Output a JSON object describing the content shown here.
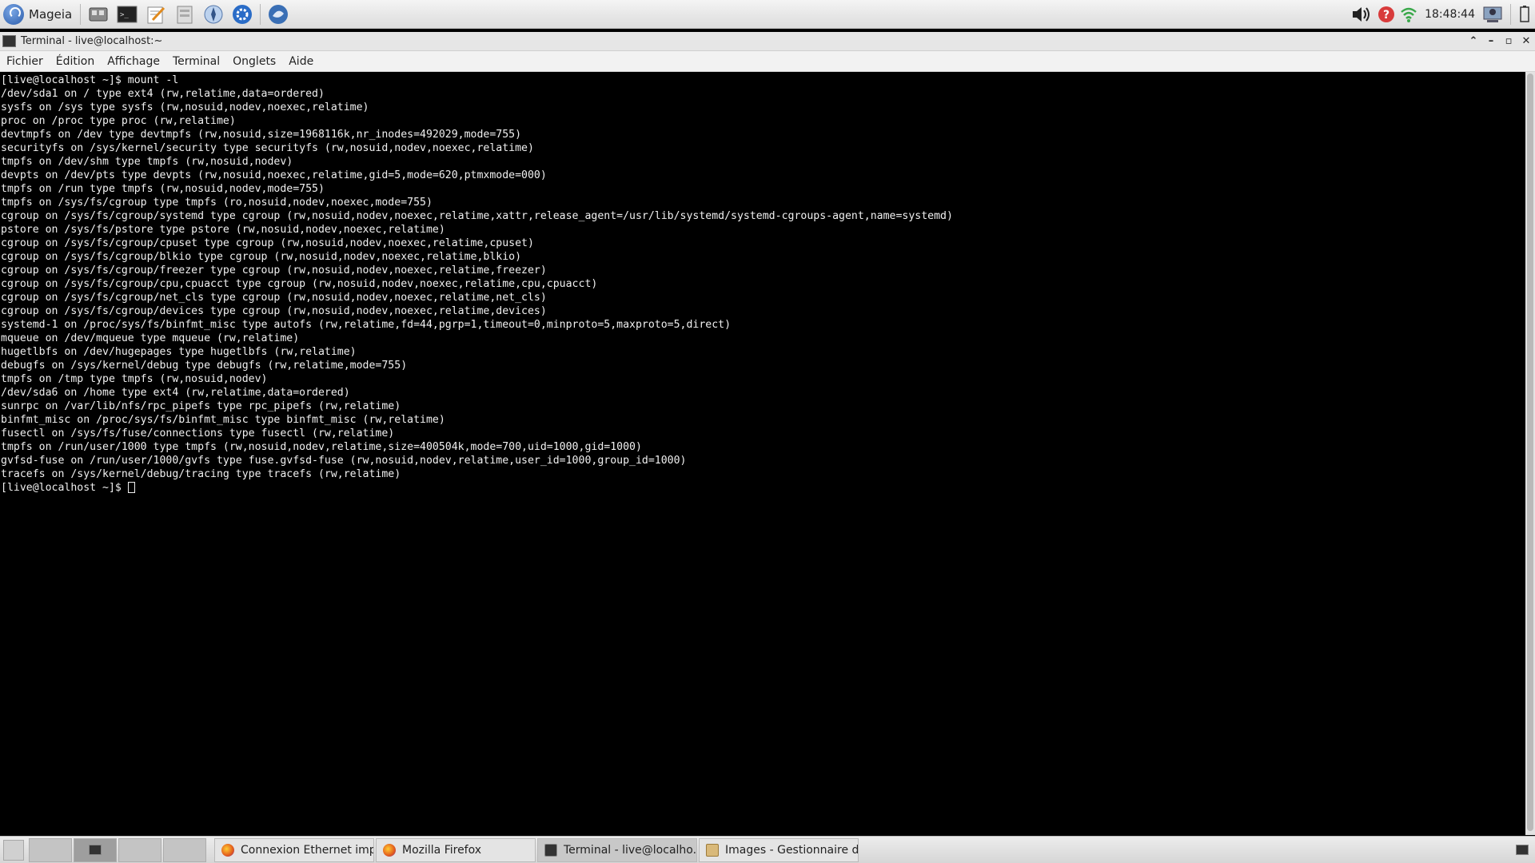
{
  "top_panel": {
    "menu_label": "Mageia",
    "launchers": [
      {
        "icon": "control-center-icon"
      },
      {
        "icon": "terminal-icon"
      },
      {
        "icon": "text-editor-icon"
      },
      {
        "icon": "file-manager-icon"
      },
      {
        "icon": "web-browser-icon"
      },
      {
        "icon": "settings-icon"
      },
      {
        "icon": "mail-icon"
      }
    ],
    "clock": "18:48:44",
    "colors": {
      "accent": "#2a5ba9",
      "help": "#d83b3b",
      "wifi": "#3aa84a"
    }
  },
  "window": {
    "title": "Terminal - live@localhost:~",
    "menu": [
      "Fichier",
      "Édition",
      "Affichage",
      "Terminal",
      "Onglets",
      "Aide"
    ]
  },
  "terminal": {
    "lines": [
      "[live@localhost ~]$ mount -l",
      "/dev/sda1 on / type ext4 (rw,relatime,data=ordered)",
      "sysfs on /sys type sysfs (rw,nosuid,nodev,noexec,relatime)",
      "proc on /proc type proc (rw,relatime)",
      "devtmpfs on /dev type devtmpfs (rw,nosuid,size=1968116k,nr_inodes=492029,mode=755)",
      "securityfs on /sys/kernel/security type securityfs (rw,nosuid,nodev,noexec,relatime)",
      "tmpfs on /dev/shm type tmpfs (rw,nosuid,nodev)",
      "devpts on /dev/pts type devpts (rw,nosuid,noexec,relatime,gid=5,mode=620,ptmxmode=000)",
      "tmpfs on /run type tmpfs (rw,nosuid,nodev,mode=755)",
      "tmpfs on /sys/fs/cgroup type tmpfs (ro,nosuid,nodev,noexec,mode=755)",
      "cgroup on /sys/fs/cgroup/systemd type cgroup (rw,nosuid,nodev,noexec,relatime,xattr,release_agent=/usr/lib/systemd/systemd-cgroups-agent,name=systemd)",
      "pstore on /sys/fs/pstore type pstore (rw,nosuid,nodev,noexec,relatime)",
      "cgroup on /sys/fs/cgroup/cpuset type cgroup (rw,nosuid,nodev,noexec,relatime,cpuset)",
      "cgroup on /sys/fs/cgroup/blkio type cgroup (rw,nosuid,nodev,noexec,relatime,blkio)",
      "cgroup on /sys/fs/cgroup/freezer type cgroup (rw,nosuid,nodev,noexec,relatime,freezer)",
      "cgroup on /sys/fs/cgroup/cpu,cpuacct type cgroup (rw,nosuid,nodev,noexec,relatime,cpu,cpuacct)",
      "cgroup on /sys/fs/cgroup/net_cls type cgroup (rw,nosuid,nodev,noexec,relatime,net_cls)",
      "cgroup on /sys/fs/cgroup/devices type cgroup (rw,nosuid,nodev,noexec,relatime,devices)",
      "systemd-1 on /proc/sys/fs/binfmt_misc type autofs (rw,relatime,fd=44,pgrp=1,timeout=0,minproto=5,maxproto=5,direct)",
      "mqueue on /dev/mqueue type mqueue (rw,relatime)",
      "hugetlbfs on /dev/hugepages type hugetlbfs (rw,relatime)",
      "debugfs on /sys/kernel/debug type debugfs (rw,relatime,mode=755)",
      "tmpfs on /tmp type tmpfs (rw,nosuid,nodev)",
      "/dev/sda6 on /home type ext4 (rw,relatime,data=ordered)",
      "sunrpc on /var/lib/nfs/rpc_pipefs type rpc_pipefs (rw,relatime)",
      "binfmt_misc on /proc/sys/fs/binfmt_misc type binfmt_misc (rw,relatime)",
      "fusectl on /sys/fs/fuse/connections type fusectl (rw,relatime)",
      "tmpfs on /run/user/1000 type tmpfs (rw,nosuid,nodev,relatime,size=400504k,mode=700,uid=1000,gid=1000)",
      "gvfsd-fuse on /run/user/1000/gvfs type fuse.gvfsd-fuse (rw,nosuid,nodev,relatime,user_id=1000,group_id=1000)",
      "tracefs on /sys/kernel/debug/tracing type tracefs (rw,relatime)"
    ],
    "prompt": "[live@localhost ~]$ "
  },
  "taskbar": {
    "tasks": [
      {
        "label": "Connexion Ethernet imp...",
        "icon": "firefox-icon",
        "active": false
      },
      {
        "label": "Mozilla Firefox",
        "icon": "firefox-icon",
        "active": false
      },
      {
        "label": "Terminal - live@localho...",
        "icon": "terminal-icon",
        "active": true
      },
      {
        "label": "Images - Gestionnaire d...",
        "icon": "file-manager-icon",
        "active": false
      }
    ]
  }
}
